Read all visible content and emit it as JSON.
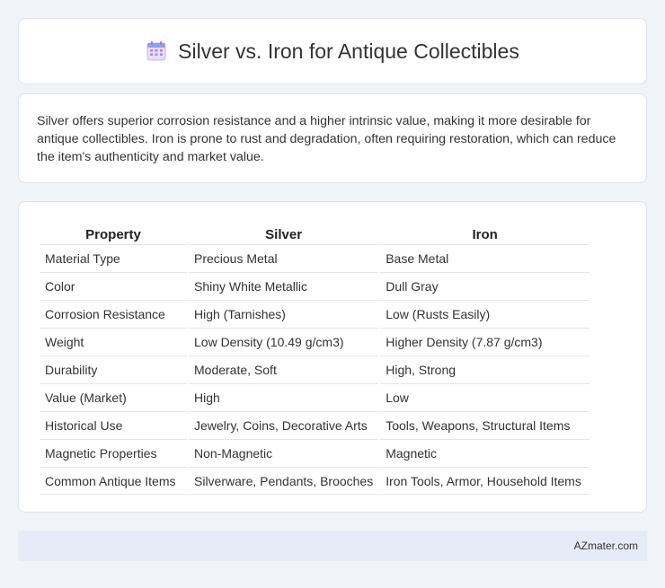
{
  "header": {
    "title": "Silver vs. Iron for Antique Collectibles",
    "icon": "calendar-icon"
  },
  "intro": {
    "text": "Silver offers superior corrosion resistance and a higher intrinsic value, making it more desirable for antique collectibles. Iron is prone to rust and degradation, often requiring restoration, which can reduce the item's authenticity and market value."
  },
  "table": {
    "headers": [
      "Property",
      "Silver",
      "Iron"
    ],
    "rows": [
      [
        "Material Type",
        "Precious Metal",
        "Base Metal"
      ],
      [
        "Color",
        "Shiny White Metallic",
        "Dull Gray"
      ],
      [
        "Corrosion Resistance",
        "High (Tarnishes)",
        "Low (Rusts Easily)"
      ],
      [
        "Weight",
        "Low Density (10.49 g/cm3)",
        "Higher Density (7.87 g/cm3)"
      ],
      [
        "Durability",
        "Moderate, Soft",
        "High, Strong"
      ],
      [
        "Value (Market)",
        "High",
        "Low"
      ],
      [
        "Historical Use",
        "Jewelry, Coins, Decorative Arts",
        "Tools, Weapons, Structural Items"
      ],
      [
        "Magnetic Properties",
        "Non-Magnetic",
        "Magnetic"
      ],
      [
        "Common Antique Items",
        "Silverware, Pendants, Brooches",
        "Iron Tools, Armor, Household Items"
      ]
    ]
  },
  "footer": {
    "text": "AZmater.com"
  },
  "colors": {
    "background": "#f0f3f8",
    "footer_bg": "#e6ecf7",
    "icon_accent": "#7b8cf0"
  }
}
